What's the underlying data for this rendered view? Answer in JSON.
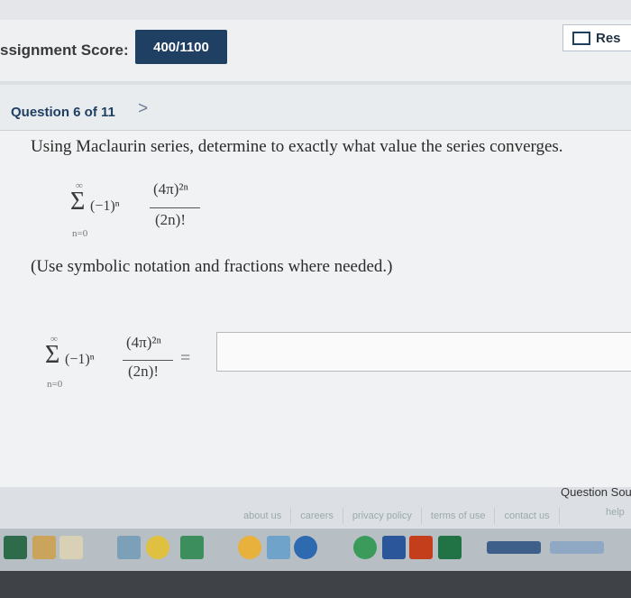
{
  "header": {
    "score_label": "ssignment Score:",
    "score_value": "400/1100",
    "res_label": "Res"
  },
  "question": {
    "number": "Question 6 of 11",
    "next": ">",
    "text": "Using Maclaurin series, determine to exactly what value the series converges.",
    "hint": "(Use symbolic notation and fractions where needed.)"
  },
  "expr": {
    "sigma": "Σ",
    "upper": "∞",
    "lower": "n=0",
    "term": "(−1)ⁿ",
    "numerator": "(4π)²ⁿ",
    "denominator": "(2n)!",
    "equals": "="
  },
  "answer": {
    "value": ""
  },
  "footer": {
    "question_source": "Question Sou",
    "links": [
      "about us",
      "careers",
      "privacy policy",
      "terms of use",
      "contact us"
    ],
    "help": "help"
  },
  "colors": {
    "brand": "#1f3f63",
    "panel": "#f1f2f3"
  }
}
